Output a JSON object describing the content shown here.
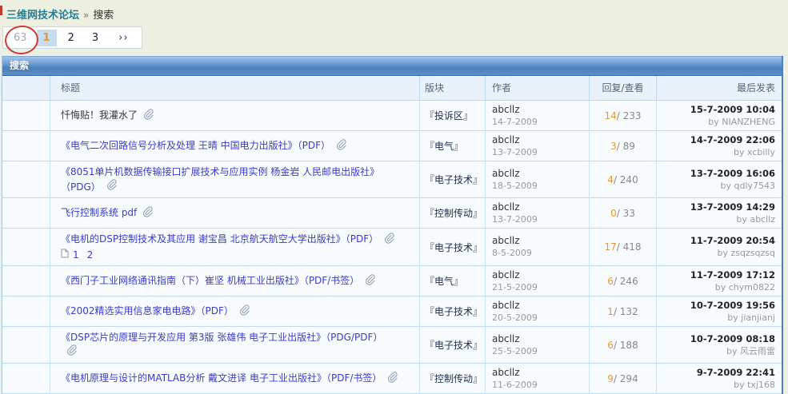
{
  "breadcrumb": {
    "forum": "三维网技术论坛",
    "separator": "»",
    "current": "搜索"
  },
  "pagination": {
    "total_pages": "63",
    "current": "1",
    "others": [
      "2",
      "3"
    ],
    "next_symbol": "››"
  },
  "table": {
    "title": "搜索",
    "by_label": "by",
    "columns": {
      "title": "标题",
      "forum": "版块",
      "author": "作者",
      "replies": "回复/查看",
      "lastpost": "最后发表"
    },
    "rows": [
      {
        "title": "忏悔贴！我灌水了",
        "plain": true,
        "clip_line": 1,
        "title_wrap": "",
        "pages": [],
        "forum": "『投诉区』",
        "author": "abcllz",
        "date": "14-7-2009",
        "replies": "14",
        "views": "233",
        "last_date": "15-7-2009 10:04",
        "last_user": "NIANZHENG"
      },
      {
        "title": "《电气二次回路信号分析及处理 王晴 中国电力出版社》（PDF）",
        "plain": false,
        "clip_line": 1,
        "title_wrap": "",
        "pages": [],
        "forum": "『电气』",
        "author": "abcllz",
        "date": "13-7-2009",
        "replies": "3",
        "views": "89",
        "last_date": "14-7-2009 22:06",
        "last_user": "xcbilly"
      },
      {
        "title": "《8051单片机数据传输接口扩展技术与应用实例 杨金岩 人民邮电出版社》",
        "plain": false,
        "clip_line": 2,
        "title_wrap": "（PDG）",
        "pages": [],
        "forum": "『电子技术』",
        "author": "abcllz",
        "date": "18-5-2009",
        "replies": "4",
        "views": "240",
        "last_date": "13-7-2009 16:06",
        "last_user": "qdly7543"
      },
      {
        "title": "飞行控制系统 pdf",
        "plain": false,
        "clip_line": 1,
        "title_wrap": "",
        "pages": [],
        "forum": "『控制传动』",
        "author": "abcllz",
        "date": "13-7-2009",
        "replies": "0",
        "views": "33",
        "last_date": "13-7-2009 14:29",
        "last_user": "abcllz"
      },
      {
        "title": "《电机的DSP控制技术及其应用 谢宝昌 北京航天航空大学出版社》（PDF）",
        "plain": false,
        "clip_line": 1,
        "title_wrap": "",
        "pages": [
          "1",
          "2"
        ],
        "forum": "『电子技术』",
        "author": "abcllz",
        "date": "8-5-2009",
        "replies": "17",
        "views": "418",
        "last_date": "11-7-2009 20:54",
        "last_user": "zsqzsqzsq"
      },
      {
        "title": "《西门子工业网络通讯指南（下）崔坚 机械工业出版社》（PDF/书签）",
        "plain": false,
        "clip_line": 1,
        "title_wrap": "",
        "pages": [],
        "forum": "『电气』",
        "author": "abcllz",
        "date": "21-5-2009",
        "replies": "6",
        "views": "246",
        "last_date": "11-7-2009 17:12",
        "last_user": "chym0822"
      },
      {
        "title": "《2002精选实用信息家电电路》（PDF）",
        "plain": false,
        "clip_line": 1,
        "title_wrap": "",
        "pages": [],
        "forum": "『电子技术』",
        "author": "abcllz",
        "date": "20-5-2009",
        "replies": "1",
        "views": "132",
        "last_date": "10-7-2009 19:56",
        "last_user": "jianjianj"
      },
      {
        "title": "《DSP芯片的原理与开发应用 第3版 张雄伟 电子工业出版社》（PDG/PDF）",
        "plain": false,
        "clip_line": 2,
        "title_wrap": "",
        "pages": [],
        "forum": "『电子技术』",
        "author": "abcllz",
        "date": "25-5-2009",
        "replies": "6",
        "views": "188",
        "last_date": "10-7-2009 08:18",
        "last_user": "风云雨雷"
      },
      {
        "title": "《电机原理与设计的MATLAB分析 戴文进译 电子工业出版社》（PDF/书签）",
        "plain": false,
        "clip_line": 1,
        "title_wrap": "",
        "pages": [],
        "forum": "『控制传动』",
        "author": "abcllz",
        "date": "11-6-2009",
        "replies": "9",
        "views": "294",
        "last_date": "9-7-2009 22:41",
        "last_user": "txj168"
      }
    ]
  },
  "colors": {
    "page_bg": "#EDEFE1",
    "breadcrumb_link": "#1E7E96",
    "title_link_blue": "#3A3CC6",
    "plain_title": "#333333",
    "reply_count_orange": "#E8972F",
    "header_bar_blue": "#4C80BC",
    "column_header_bg": "#E9F2FB",
    "row_bg": "#F8FBFE",
    "cell_border_blue": "#BFD8EE",
    "table_right_border": "#4E81B8",
    "current_page_bg": "#C9DCEE",
    "current_page_text": "#E09A33",
    "annotation_red": "#CC3B33",
    "muted_gray": "#999999"
  }
}
